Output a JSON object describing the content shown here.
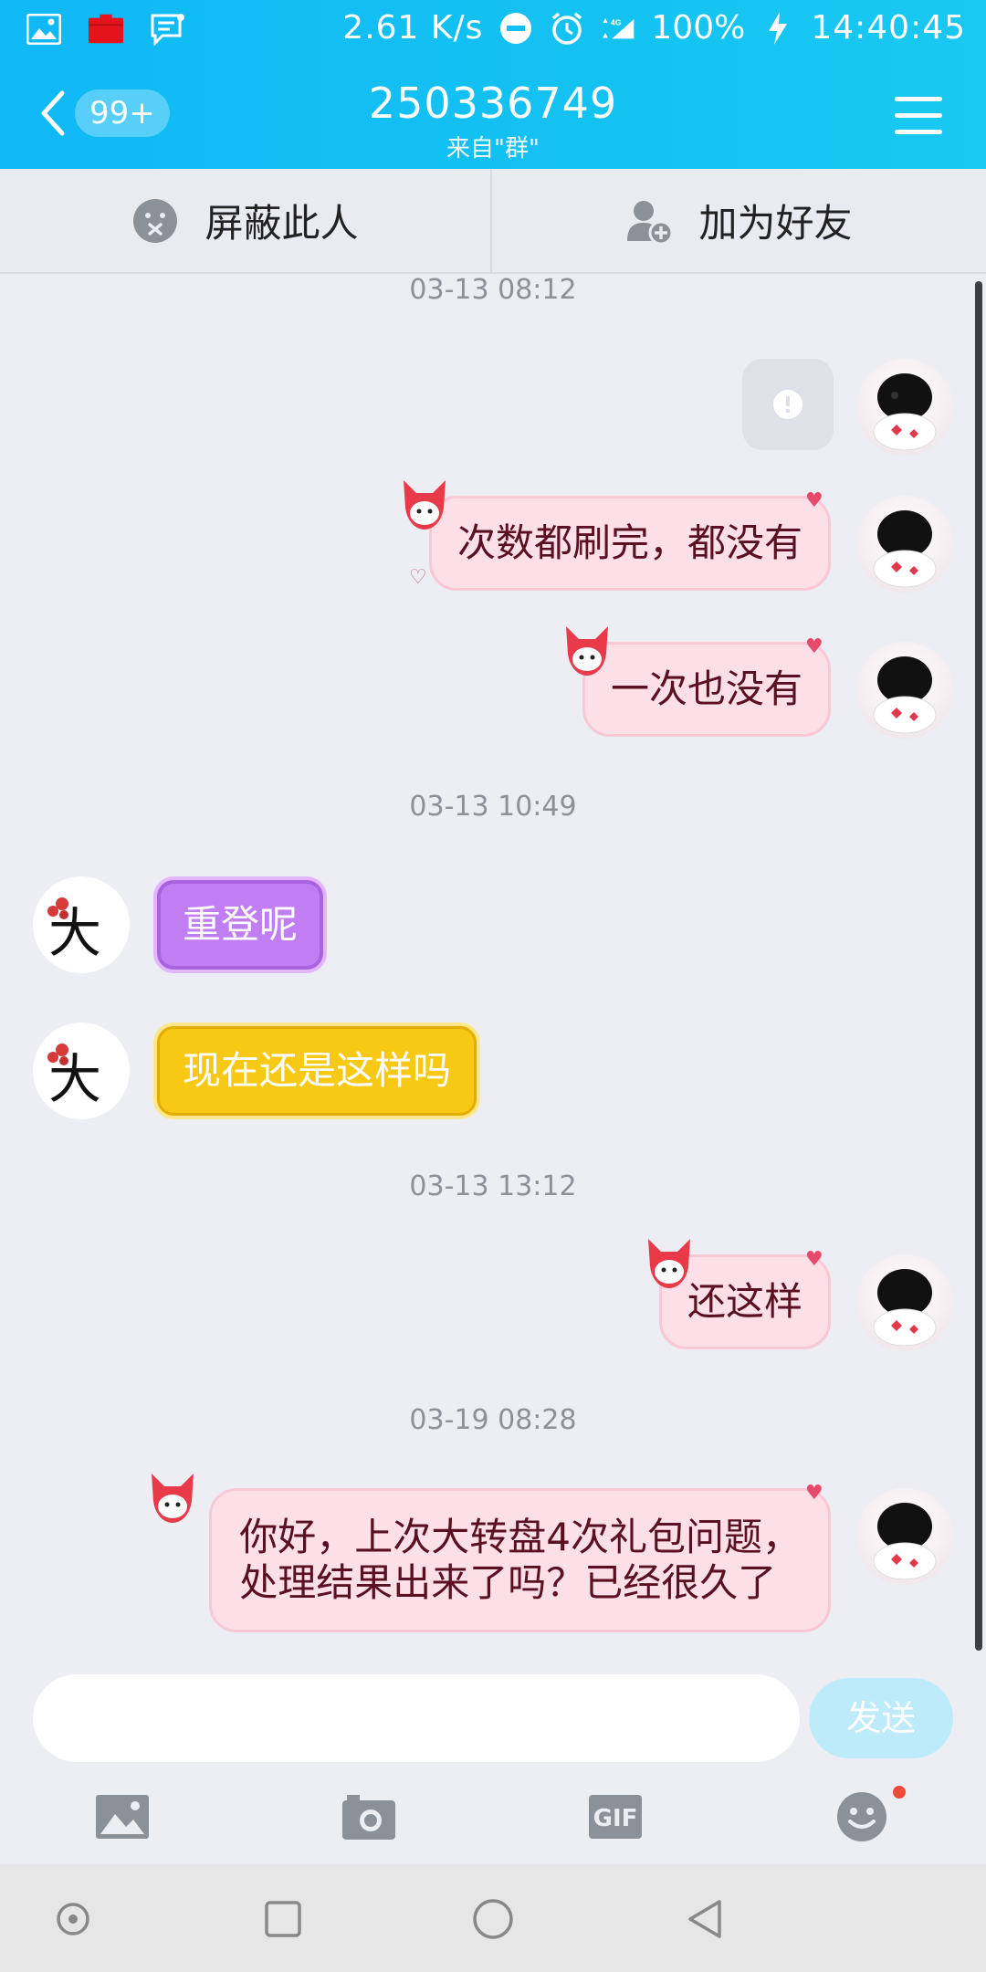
{
  "status_bar": {
    "net_speed": "2.61 K/s",
    "network": "4G",
    "battery": "100%",
    "time": "14:40:45"
  },
  "header": {
    "badge": "99+",
    "title": "250336749",
    "subtitle": "来自\"群\""
  },
  "actions": {
    "block_label": "屏蔽此人",
    "add_friend_label": "加为好友"
  },
  "messages": {
    "t1": "03-13 08:12",
    "m1": "次数都刷完，都没有",
    "m2": "一次也没有",
    "t2": "03-13 10:49",
    "m3": "重登呢",
    "m4": "现在还是这样吗",
    "t3": "03-13 13:12",
    "m5": "还这样",
    "t4": "03-19 08:28",
    "m6_line1": "你好，上次大转盘4次礼包问题，",
    "m6_line2": "处理结果出来了吗？已经很久了"
  },
  "avatars": {
    "other_char": "大"
  },
  "input": {
    "placeholder": "",
    "send_label": "发送"
  },
  "toolbar": {
    "gif_label": "GIF"
  },
  "colors": {
    "header": "#14c2f2",
    "pink_bubble": "#fcdfe7",
    "purple_bubble": "#c07ef2",
    "yellow_bubble": "#f8c914",
    "send_button": "#bdebfa"
  }
}
